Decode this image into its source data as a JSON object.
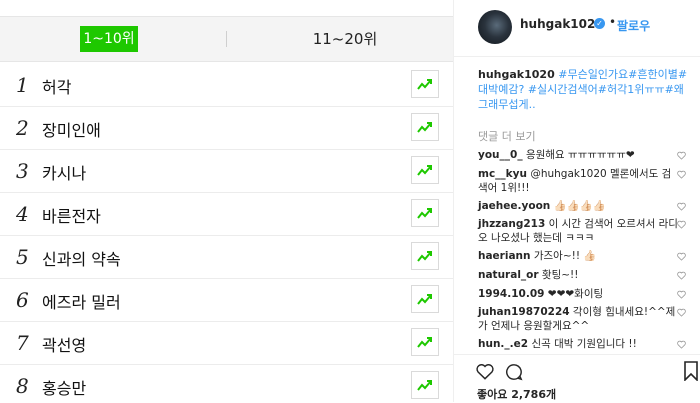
{
  "tabs": {
    "active": "1~10위",
    "second": "11~20위"
  },
  "ranking": [
    {
      "rank": "1",
      "name": "허각"
    },
    {
      "rank": "2",
      "name": "장미인애"
    },
    {
      "rank": "3",
      "name": "카시나"
    },
    {
      "rank": "4",
      "name": "바른전자"
    },
    {
      "rank": "5",
      "name": "신과의 약속"
    },
    {
      "rank": "6",
      "name": "에즈라 밀러"
    },
    {
      "rank": "7",
      "name": "곽선영"
    },
    {
      "rank": "8",
      "name": "홍승만"
    }
  ],
  "post": {
    "username": "huhgak1020",
    "dot": "•",
    "follow": "팔로우",
    "caption_user": "huhgak1020",
    "caption_text": "#무슨일인가요#흔한이별#대박예감? #실시간검색어#허각1위ㅠㅠ#왜그래무섭게..",
    "more_comments": "댓글 더 보기",
    "comments": [
      {
        "user": "you__0_",
        "text": "응원해요 ㅠㅠㅠㅠㅠㅠ❤"
      },
      {
        "user": "mc__kyu",
        "text": "@huhgak1020 멜론에서도 검색어 1위!!!"
      },
      {
        "user": "jaehee.yoon",
        "text": "👍🏻👍🏻👍🏻👍🏻"
      },
      {
        "user": "jhzzang213",
        "text": "이 시간 검색어 오르셔서 라디오 나오셨나 했는데 ㅋㅋㅋ"
      },
      {
        "user": "haeriann",
        "text": "가즈아~!! 👍🏻"
      },
      {
        "user": "natural_or",
        "text": "홧팅~!!"
      },
      {
        "user": "1994.10.09",
        "text": "❤❤❤화이팅"
      },
      {
        "user": "juhan19870224",
        "text": "각이형 힘내세요!^^제가 언제나 응원할게요^^"
      },
      {
        "user": "hun._.e2",
        "text": "신곡 대박 기원입니다 !!"
      }
    ],
    "likes": "좋아요 2,786개"
  },
  "colors": {
    "accent_green": "#1ec800",
    "link_blue": "#3897f0"
  }
}
